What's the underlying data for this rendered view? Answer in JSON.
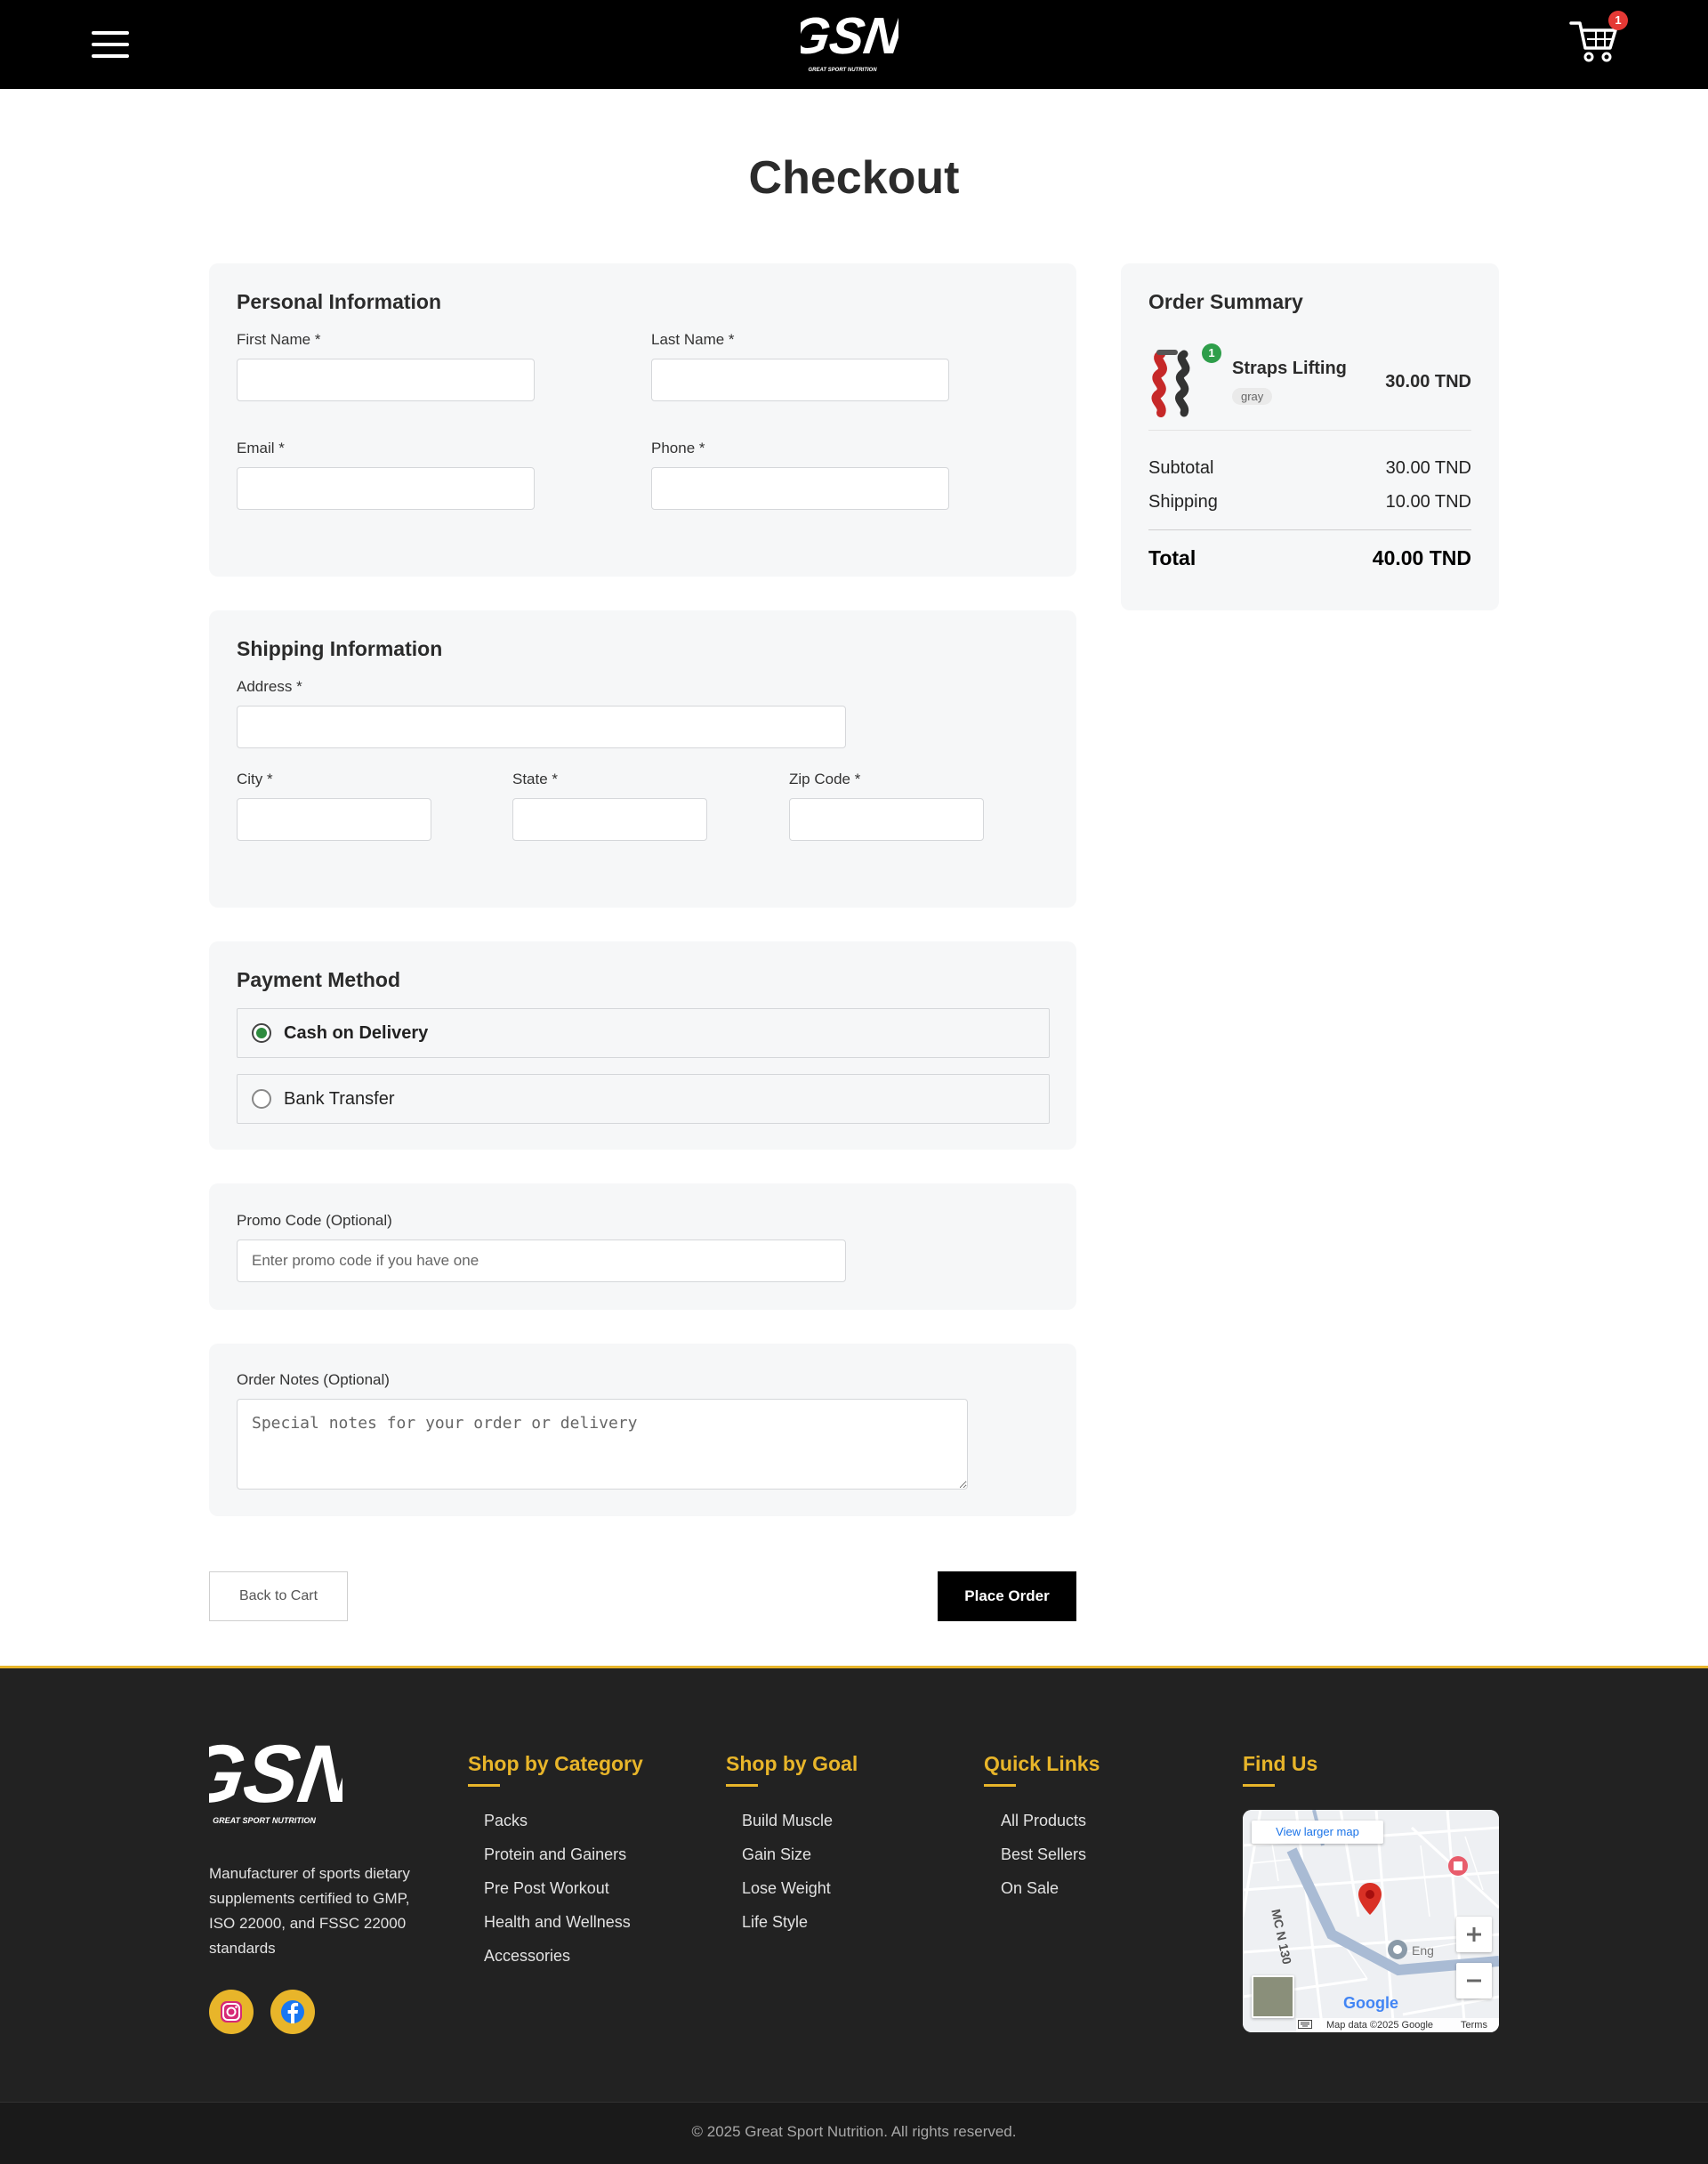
{
  "header": {
    "logo_text": "GSN",
    "logo_sub": "GREAT SPORT NUTRITION",
    "cart_count": "1"
  },
  "page": {
    "title": "Checkout"
  },
  "personal": {
    "title": "Personal Information",
    "first_name": "First Name *",
    "last_name": "Last Name *",
    "email": "Email *",
    "phone": "Phone *"
  },
  "shipping": {
    "title": "Shipping Information",
    "address": "Address *",
    "city": "City *",
    "state": "State *",
    "zip": "Zip Code *"
  },
  "payment": {
    "title": "Payment Method",
    "options": [
      {
        "label": "Cash on Delivery",
        "selected": true
      },
      {
        "label": "Bank Transfer",
        "selected": false
      }
    ]
  },
  "promo": {
    "label": "Promo Code (Optional)",
    "placeholder": "Enter promo code if you have one"
  },
  "notes": {
    "label": "Order Notes (Optional)",
    "placeholder": "Special notes for your order or delivery"
  },
  "actions": {
    "back": "Back to Cart",
    "place": "Place Order"
  },
  "summary": {
    "title": "Order Summary",
    "item": {
      "name": "Straps Lifting",
      "variant": "gray",
      "qty": "1",
      "price": "30.00 TND"
    },
    "subtotal_label": "Subtotal",
    "subtotal": "30.00 TND",
    "shipping_label": "Shipping",
    "shipping": "10.00 TND",
    "total_label": "Total",
    "total": "40.00 TND"
  },
  "footer": {
    "description": "Manufacturer of sports dietary supplements certified to GMP, ISO 22000, and FSSC 22000 standards",
    "columns": [
      {
        "title": "Shop by Category",
        "links": [
          "Packs",
          "Protein and Gainers",
          "Pre Post Workout",
          "Health and Wellness",
          "Accessories"
        ]
      },
      {
        "title": "Shop by Goal",
        "links": [
          "Build Muscle",
          "Gain Size",
          "Lose Weight",
          "Life Style"
        ]
      },
      {
        "title": "Quick Links",
        "links": [
          "All Products",
          "Best Sellers",
          "On Sale"
        ]
      }
    ],
    "find_us": "Find Us",
    "map": {
      "larger": "View larger map",
      "road": "MC N 130",
      "place": "Eng",
      "attribution": "Map data ©2025 Google",
      "terms": "Terms",
      "brand": "Google"
    },
    "copyright": "© 2025 Great Sport Nutrition. All rights reserved."
  },
  "colors": {
    "accent": "#e8b52a",
    "selected_radio": "#2e8b3e",
    "badge": "#e53935"
  }
}
